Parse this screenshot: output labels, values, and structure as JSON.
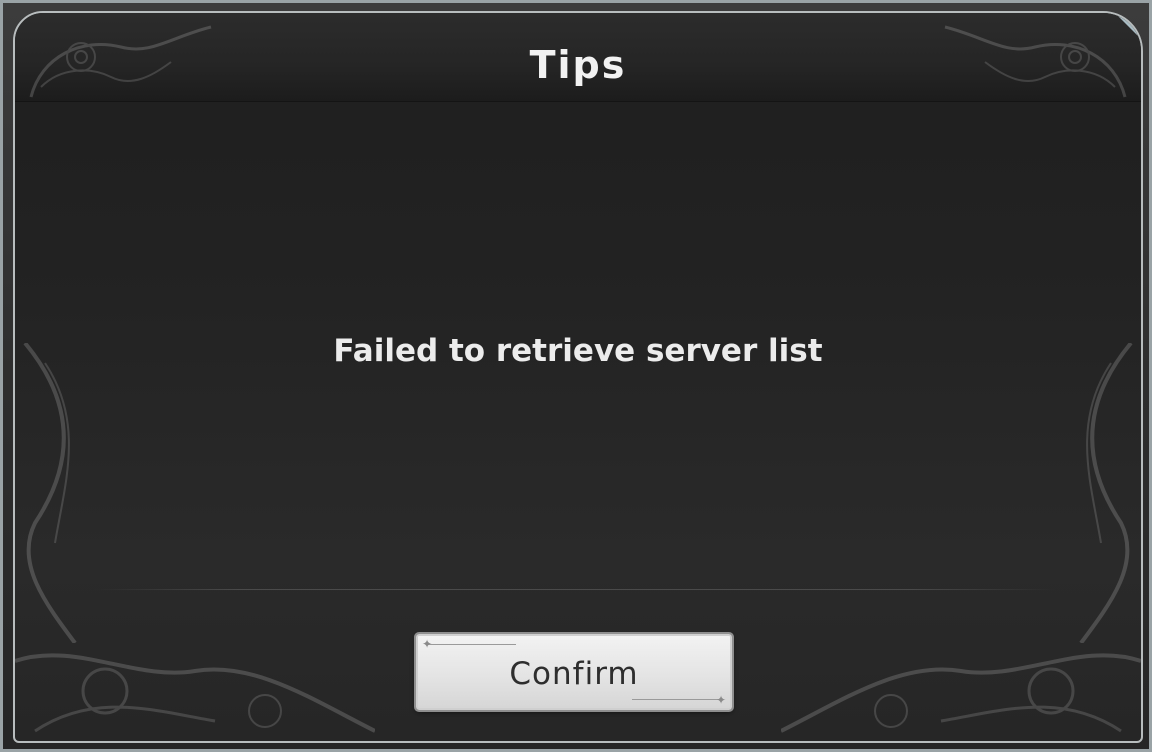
{
  "dialog": {
    "title": "Tips",
    "message": "Failed to retrieve server list",
    "confirm_label": "Confirm"
  },
  "icons": {
    "corner_ornament": "filigree-ornament",
    "button_sparkle": "sparkle-icon"
  },
  "colors": {
    "panel_background": "#232323",
    "frame_border": "#b8bdbe",
    "title_text": "#f2f2f2",
    "button_background": "#e8e8e8",
    "button_text": "#2e2e2e"
  }
}
